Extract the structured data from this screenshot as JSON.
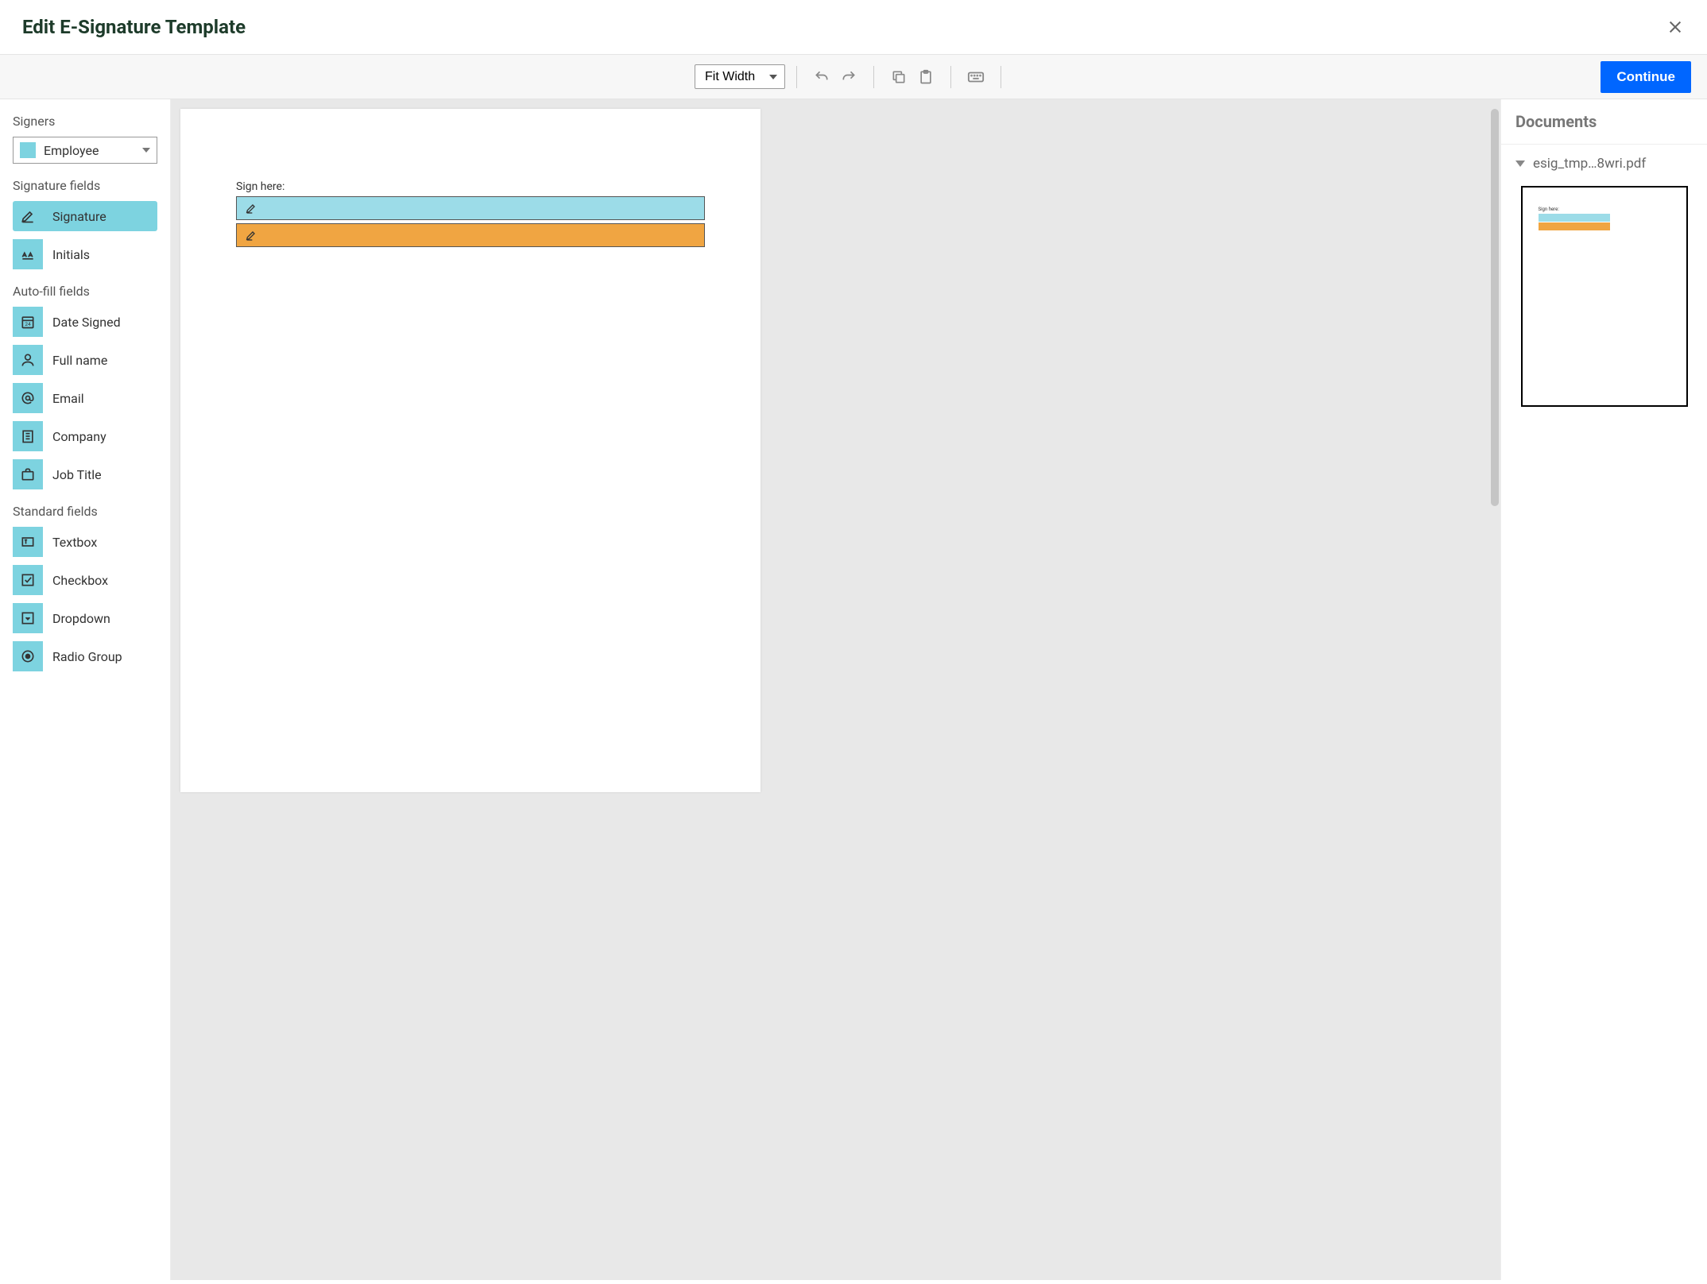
{
  "header": {
    "title": "Edit E-Signature Template"
  },
  "toolbar": {
    "zoom_selected": "Fit Width",
    "continue_label": "Continue"
  },
  "sidebar": {
    "signers_label": "Signers",
    "signer_selected": "Employee",
    "sig_fields_label": "Signature fields",
    "sig_fields": [
      {
        "label": "Signature"
      },
      {
        "label": "Initials"
      }
    ],
    "autofill_label": "Auto-fill fields",
    "autofill_fields": [
      {
        "label": "Date Signed"
      },
      {
        "label": "Full name"
      },
      {
        "label": "Email"
      },
      {
        "label": "Company"
      },
      {
        "label": "Job Title"
      }
    ],
    "standard_label": "Standard fields",
    "standard_fields": [
      {
        "label": "Textbox"
      },
      {
        "label": "Checkbox"
      },
      {
        "label": "Dropdown"
      },
      {
        "label": "Radio Group"
      }
    ]
  },
  "canvas": {
    "sign_label": "Sign here:"
  },
  "documents_panel": {
    "heading": "Documents",
    "file_name": "esig_tmp…8wri.pdf",
    "thumb_label": "Sign here:"
  }
}
